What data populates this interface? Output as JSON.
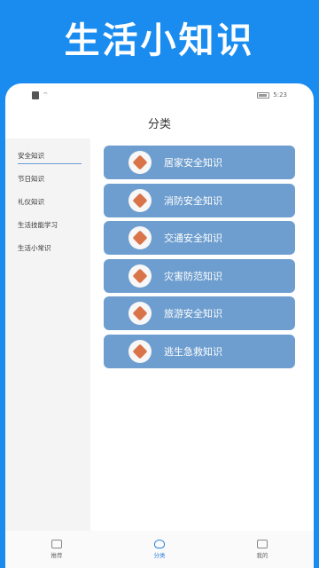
{
  "banner": {
    "title": "生活小知识"
  },
  "status": {
    "time": "5:23"
  },
  "header": {
    "title": "分类"
  },
  "sidebar": {
    "items": [
      {
        "label": "安全知识"
      },
      {
        "label": "节日知识"
      },
      {
        "label": "礼仪知识"
      },
      {
        "label": "生活技能学习"
      },
      {
        "label": "生活小常识"
      }
    ]
  },
  "cards": [
    {
      "label": "居家安全知识"
    },
    {
      "label": "消防安全知识"
    },
    {
      "label": "交通安全知识"
    },
    {
      "label": "灾害防范知识"
    },
    {
      "label": "旅游安全知识"
    },
    {
      "label": "逃生急救知识"
    }
  ],
  "nav": {
    "items": [
      {
        "label": "推荐"
      },
      {
        "label": "分类"
      },
      {
        "label": "我的"
      }
    ]
  },
  "colors": {
    "banner_bg": "#1a8cf0",
    "card_bg": "#6e9ecf",
    "accent": "#2a7fe0"
  }
}
